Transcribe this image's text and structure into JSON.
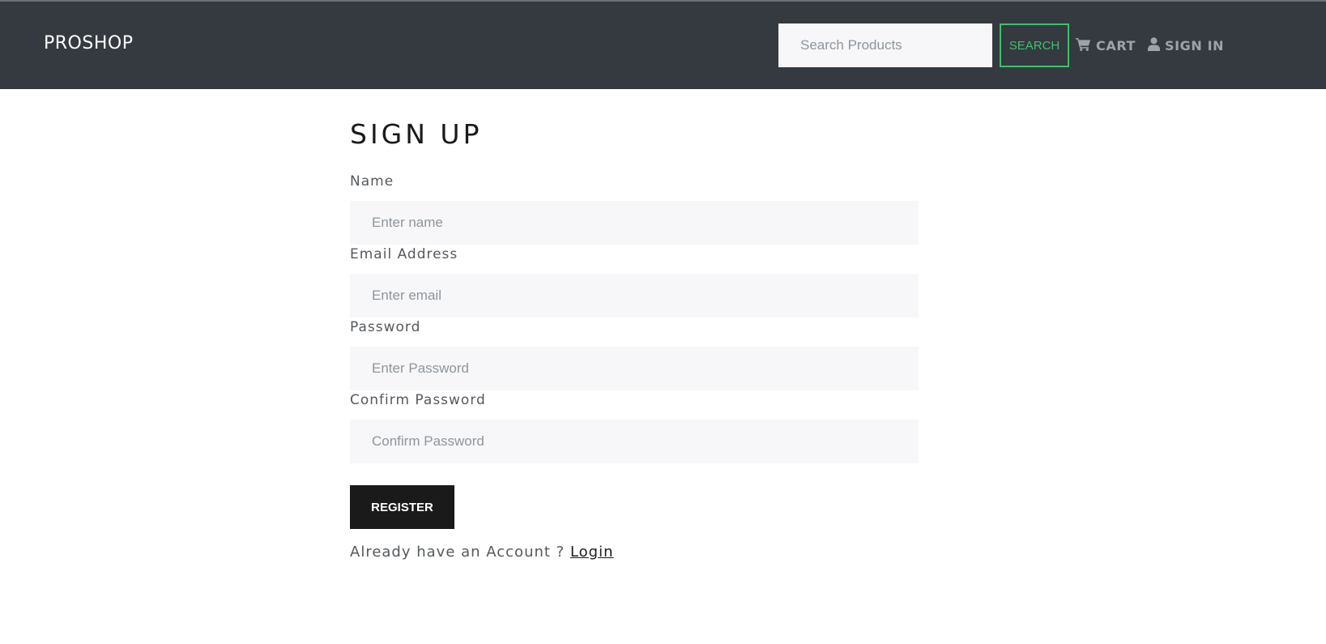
{
  "navbar": {
    "brand": "PROSHOP",
    "search_placeholder": "Search Products",
    "search_button": "SEARCH",
    "cart_label": "CART",
    "signin_label": "SIGN IN",
    "accent_color": "#40c06a",
    "background_color": "#343a40"
  },
  "form": {
    "title": "SIGN UP",
    "fields": [
      {
        "label": "Name",
        "placeholder": "Enter name",
        "value": ""
      },
      {
        "label": "Email Address",
        "placeholder": "Enter email",
        "value": ""
      },
      {
        "label": "Password",
        "placeholder": "Enter Password",
        "value": ""
      },
      {
        "label": "Confirm Password",
        "placeholder": "Confirm Password",
        "value": ""
      }
    ],
    "register_button": "REGISTER",
    "already_text": "Already have an Account ? ",
    "login_link": "Login"
  }
}
